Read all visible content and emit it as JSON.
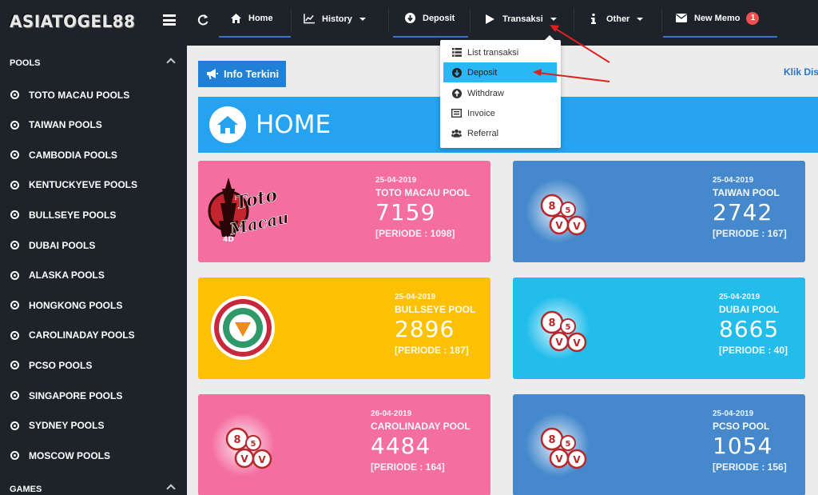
{
  "app": {
    "logo_text": "ASIATOGEL88"
  },
  "nav": {
    "home": "Home",
    "history": "History",
    "deposit": "Deposit",
    "transaksi": "Transaksi",
    "other": "Other",
    "new_memo": "New Memo",
    "memo_count": "1"
  },
  "dropdown": {
    "items": [
      "List transaksi",
      "Deposit",
      "Withdraw",
      "Invoice",
      "Referral"
    ],
    "active": "Deposit"
  },
  "sidebar": {
    "pools_header": "POOLS",
    "games_header": "GAMES",
    "items": [
      "TOTO MACAU POOLS",
      "TAIWAN POOLS",
      "CAMBODIA POOLS",
      "KENTUCKYEVE POOLS",
      "BULLSEYE POOLS",
      "DUBAI POOLS",
      "ALASKA POOLS",
      "HONGKONG POOLS",
      "CAROLINADAY POOLS",
      "PCSO POOLS",
      "SINGAPORE POOLS",
      "SYDNEY POOLS",
      "MOSCOW POOLS"
    ]
  },
  "main": {
    "info_button": "Info Terkini",
    "klik_text": "Klik Dis",
    "home_title": "HOME"
  },
  "cards": [
    {
      "date": "25-04-2019",
      "name": "TOTO MACAU POOL",
      "number": "7159",
      "periode": "[PERIODE : 1098]",
      "color": "#f46ea0",
      "logo": "toto-macau-logo"
    },
    {
      "date": "25-04-2019",
      "name": "TAIWAN POOL",
      "number": "2742",
      "periode": "[PERIODE : 167]",
      "color": "#4589cc",
      "logo": "lottery-balls-icon"
    },
    {
      "date": "25-04-2019",
      "name": "BULLSEYE POOL",
      "number": "2896",
      "periode": "[PERIODE : 187]",
      "color": "#fcc005",
      "logo": "bullseye-logo"
    },
    {
      "date": "25-04-2019",
      "name": "DUBAI POOL",
      "number": "8665",
      "periode": "[PERIODE : 40]",
      "color": "#22bdeb",
      "logo": "lottery-balls-icon"
    },
    {
      "date": "26-04-2019",
      "name": "CAROLINADAY POOL",
      "number": "4484",
      "periode": "[PERIODE : 164]",
      "color": "#f46ea0",
      "logo": "lottery-balls-icon"
    },
    {
      "date": "25-04-2019",
      "name": "PCSO POOL",
      "number": "1054",
      "periode": "[PERIODE : 156]",
      "color": "#4589cc",
      "logo": "lottery-balls-icon"
    }
  ],
  "colors": {
    "topbar": "#1d2329",
    "accent_blue": "#25a2f0",
    "annotation_red": "#e02020"
  }
}
